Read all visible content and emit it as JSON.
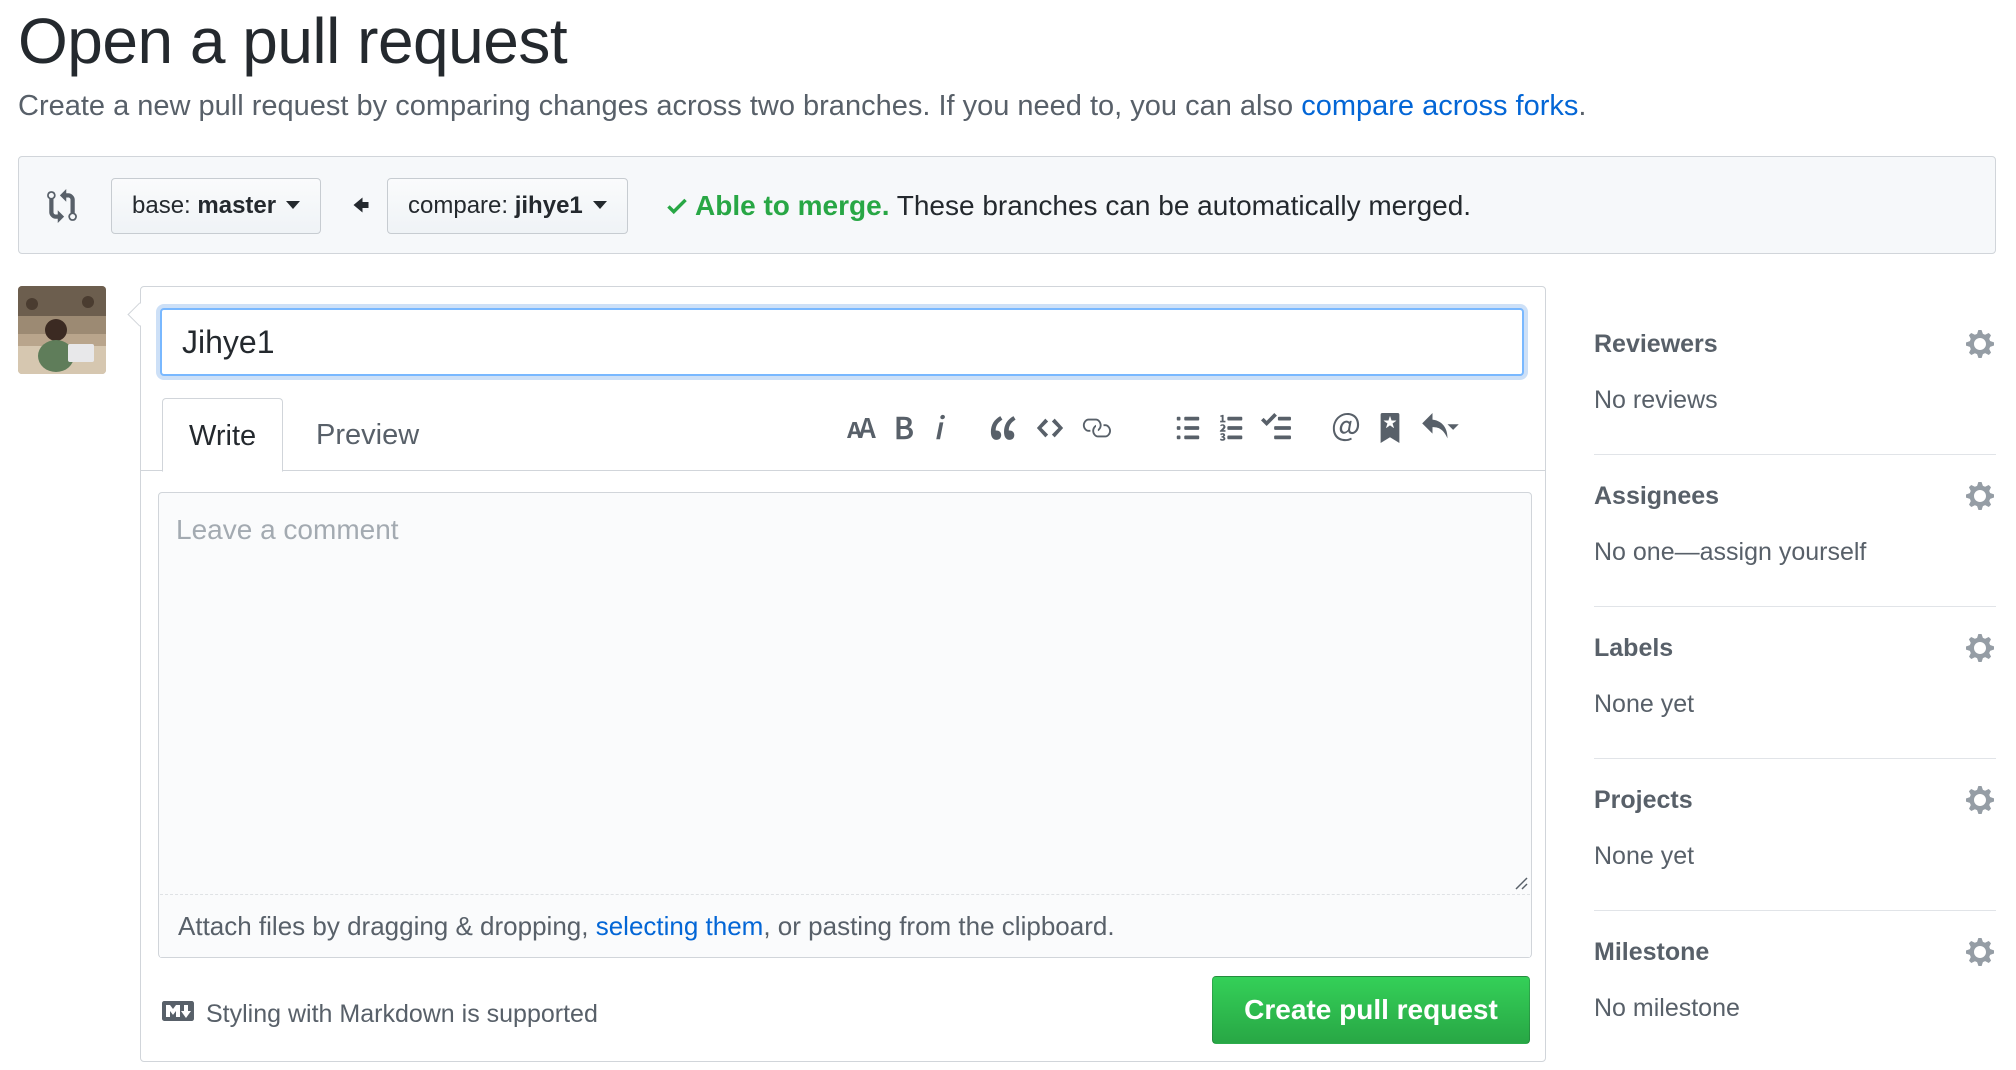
{
  "header": {
    "title": "Open a pull request",
    "subtitle_text": "Create a new pull request by comparing changes across two branches. If you need to, you can also ",
    "subtitle_link": "compare across forks",
    "subtitle_end": "."
  },
  "range": {
    "base_label": "base:",
    "base_value": "master",
    "compare_label": "compare:",
    "compare_value": "jihye1",
    "merge_ok": "Able to merge.",
    "merge_detail": " These branches can be automatically merged."
  },
  "form": {
    "title_value": "Jihye1",
    "tab_write": "Write",
    "tab_preview": "Preview",
    "comment_placeholder": "Leave a comment",
    "comment_value": "",
    "attach_text": "Attach files by dragging & dropping, ",
    "attach_link": "selecting them",
    "attach_end": ", or pasting from the clipboard.",
    "markdown_note": "Styling with Markdown is supported",
    "create_button": "Create pull request"
  },
  "toolbar": {
    "icons": [
      "text-size-icon",
      "bold-icon",
      "italic-icon",
      "quote-icon",
      "code-icon",
      "link-icon",
      "unordered-list-icon",
      "ordered-list-icon",
      "task-list-icon",
      "mention-icon",
      "bookmark-icon",
      "reply-icon"
    ]
  },
  "sidebar": {
    "reviewers_label": "Reviewers",
    "reviewers_value": "No reviews",
    "assignees_label": "Assignees",
    "assignees_value": "No one—assign yourself",
    "labels_label": "Labels",
    "labels_value": "None yet",
    "projects_label": "Projects",
    "projects_value": "None yet",
    "milestone_label": "Milestone",
    "milestone_value": "No milestone"
  },
  "colors": {
    "link": "#0366d6",
    "success": "#28a745",
    "focus": "#79b8ff"
  }
}
